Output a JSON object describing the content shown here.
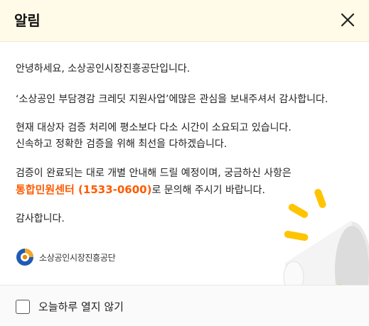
{
  "header": {
    "title": "알림"
  },
  "body": {
    "greeting": "안녕하세요, 소상공인시장진흥공단입니다.",
    "thanks_line": "‘소상공인 부담경감 크레딧 지원사업’에많은 관심을 보내주셔서 감사합니다.",
    "delay_line1": "현재 대상자 검증 처리에 평소보다 다소 시간이 소요되고 있습니다.",
    "delay_line2": "신속하고 정확한 검증을 위해 최선을 다하겠습니다.",
    "result_line1": "검증이 완료되는 대로 개별 안내해 드릴 예정이며, 궁금하신 사항은",
    "contact_highlight": "통합민원센터 (1533-0600)",
    "contact_suffix": "로 문의해 주시기 바랍니다.",
    "closing": "감사합니다."
  },
  "logo": {
    "text": "소상공인시장진흥공단"
  },
  "footer": {
    "checkbox_label": "오늘하루 열지 않기",
    "checked": false
  },
  "colors": {
    "highlight": "#ff5a00",
    "header_bg": "#fffbe8",
    "megaphone_yellow": "#ffc400"
  }
}
